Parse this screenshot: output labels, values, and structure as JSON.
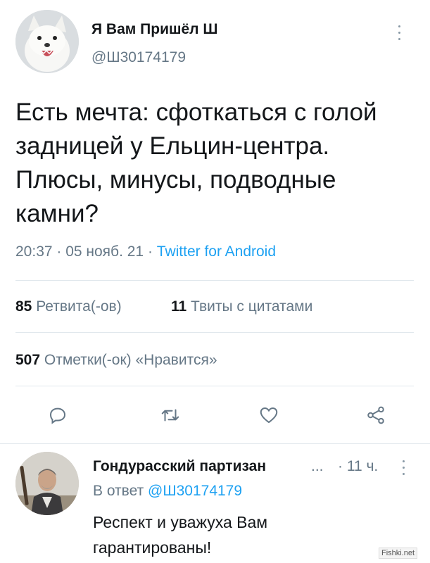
{
  "main_tweet": {
    "author_name": "Я Вам Пришёл Ш",
    "author_handle": "@Ш30174179",
    "text": "Есть мечта: сфоткаться с голой задницей у Ельцин-центра. Плюсы, минусы, подводные камни?",
    "timestamp": "20:37 · 05 нояб. 21 · ",
    "source": "Twitter for Android",
    "retweets_count": "85",
    "retweets_label": "Ретвита(-ов)",
    "quotes_count": "11",
    "quotes_label": "Твиты с цитатами",
    "likes_count": "507",
    "likes_label": "Отметки(-ок) «Нравится»",
    "avatar_icon": "arctic-fox-avatar",
    "actions": [
      "reply-icon",
      "retweet-icon",
      "like-icon",
      "share-icon"
    ]
  },
  "reply": {
    "author_name": "Гондурасский партизан",
    "ellipsis": "...",
    "time": "· 11 ч.",
    "reply_to_label": "В ответ",
    "reply_to_handle": "@Ш30174179",
    "text": "Респект и уважуха Вам гарантированы!",
    "avatar_icon": "man-with-rifle-avatar"
  },
  "watermark": "Fishki.net",
  "colors": {
    "accent": "#1da1f2",
    "secondary_text": "#657786",
    "primary_text": "#14171a",
    "divider": "#e1e8ed"
  }
}
